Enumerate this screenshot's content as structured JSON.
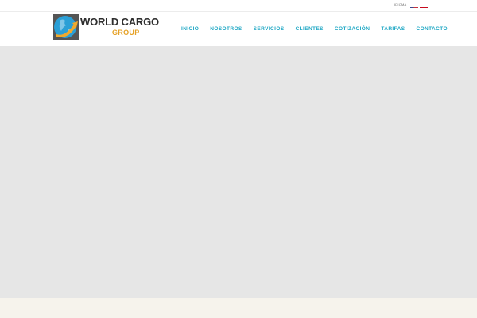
{
  "topbar": {
    "language_label": "IDIOMA",
    "flags": [
      {
        "icon": "us-flag-icon",
        "language": "English"
      },
      {
        "icon": "spain-flag-icon",
        "language": "Español"
      }
    ]
  },
  "logo": {
    "line1": "WORLD CARGO",
    "line2": "GROUP",
    "colors": {
      "globe_blue": "#2a9fd6",
      "arrow_orange": "#f0a92c",
      "dark_box": "#555555"
    }
  },
  "nav": {
    "items": [
      {
        "label": "INICIO"
      },
      {
        "label": "NOSOTROS"
      },
      {
        "label": "SERVICIOS"
      },
      {
        "label": "CLIENTES"
      },
      {
        "label": "COTIZACIÓN"
      },
      {
        "label": "TARIFAS"
      },
      {
        "label": "CONTACTO"
      }
    ],
    "color": "#1ea7c4"
  },
  "hero": {
    "background": "#e6e6e6"
  },
  "footer": {
    "background": "#f6f3ec"
  }
}
